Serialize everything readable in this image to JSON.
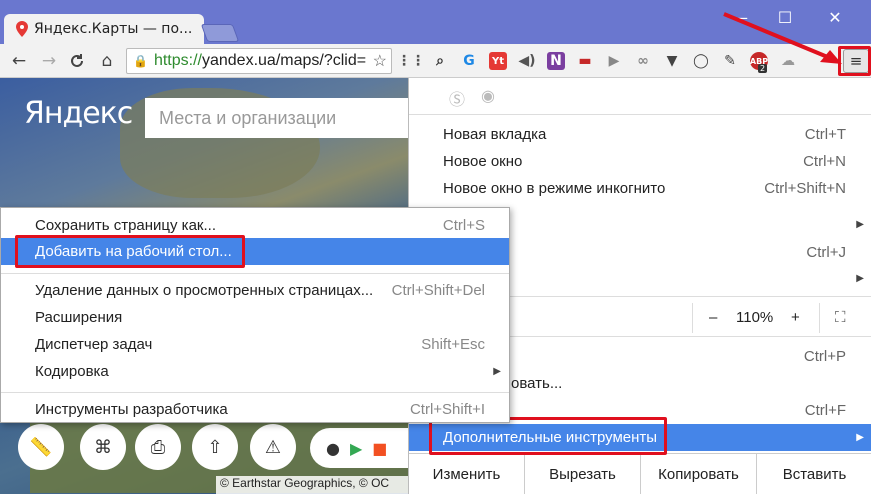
{
  "window": {
    "tab_title": "Яндекс.Карты — по...",
    "tab_close": "✕",
    "minimize": "—",
    "maximize": "☐",
    "close": "✕"
  },
  "toolbar": {
    "back": "←",
    "forward": "→",
    "reload": "C",
    "home": "⌂",
    "url_scheme": "https://",
    "url_rest": "yandex.ua/maps/?clid=",
    "extensions": [
      {
        "name": "drag-icon",
        "glyph": "⋮⋮",
        "color": "#555"
      },
      {
        "name": "search-icon",
        "glyph": "⌕",
        "color": "#333"
      },
      {
        "name": "chrome-icon",
        "glyph": "G",
        "color": "#1e88e5"
      },
      {
        "name": "yt-icon",
        "glyph": "Yt",
        "color": "#e53935"
      },
      {
        "name": "speaker-icon",
        "glyph": "◀)",
        "color": "#555"
      },
      {
        "name": "onenote-icon",
        "glyph": "N",
        "color": "#7b3fa0"
      },
      {
        "name": "sofa-icon",
        "glyph": "▬",
        "color": "#c62828"
      },
      {
        "name": "play-icon",
        "glyph": "▶",
        "color": "#888"
      },
      {
        "name": "link-icon",
        "glyph": "∞",
        "color": "#888"
      },
      {
        "name": "pocket-icon",
        "glyph": "▼",
        "color": "#444"
      },
      {
        "name": "bulb-icon",
        "glyph": "◯",
        "color": "#444"
      },
      {
        "name": "pen-icon",
        "glyph": "✎",
        "color": "#444"
      },
      {
        "name": "abp-icon",
        "glyph": "ABP",
        "color": "#c62828"
      },
      {
        "name": "cloud-icon",
        "glyph": "☁",
        "color": "#999"
      }
    ],
    "abp_badge": "2",
    "menu_icon": "≡"
  },
  "map": {
    "logo": "Яндекс",
    "search_placeholder": "Места и организации",
    "attribution": "© Earthstar Geographics, © OC",
    "buttons": [
      "ruler-icon",
      "binoculars-icon",
      "printer-icon",
      "share-icon",
      "warning-icon"
    ]
  },
  "menu": {
    "new_tab": "Новая вкладка",
    "new_tab_sc": "Ctrl+T",
    "new_window": "Новое окно",
    "new_window_sc": "Ctrl+N",
    "incognito": "Новое окно в режиме инкогнито",
    "incognito_sc": "Ctrl+Shift+N",
    "downloads_sc": "Ctrl+J",
    "zoom_minus": "–",
    "zoom_value": "110%",
    "zoom_plus": "+",
    "print_sc": "Ctrl+P",
    "partial_item": "овать...",
    "find_sc": "Ctrl+F",
    "more_tools": "Дополнительные инструменты",
    "edit_label": "Изменить",
    "cut": "Вырезать",
    "copy": "Копировать",
    "paste": "Вставить"
  },
  "submenu": {
    "save_page": "Сохранить страницу как...",
    "save_page_sc": "Ctrl+S",
    "add_to_desktop": "Добавить на рабочий стол...",
    "clear_data": "Удаление данных о просмотренных страницах...",
    "clear_data_sc": "Ctrl+Shift+Del",
    "extensions": "Расширения",
    "task_manager": "Диспетчер задач",
    "task_manager_sc": "Shift+Esc",
    "encoding": "Кодировка",
    "dev_tools": "Инструменты разработчика",
    "dev_tools_sc": "Ctrl+Shift+I"
  },
  "colors": {
    "titlebar": "#6a77cf",
    "highlight": "#4585e8",
    "annotation_red": "#e0101e"
  }
}
